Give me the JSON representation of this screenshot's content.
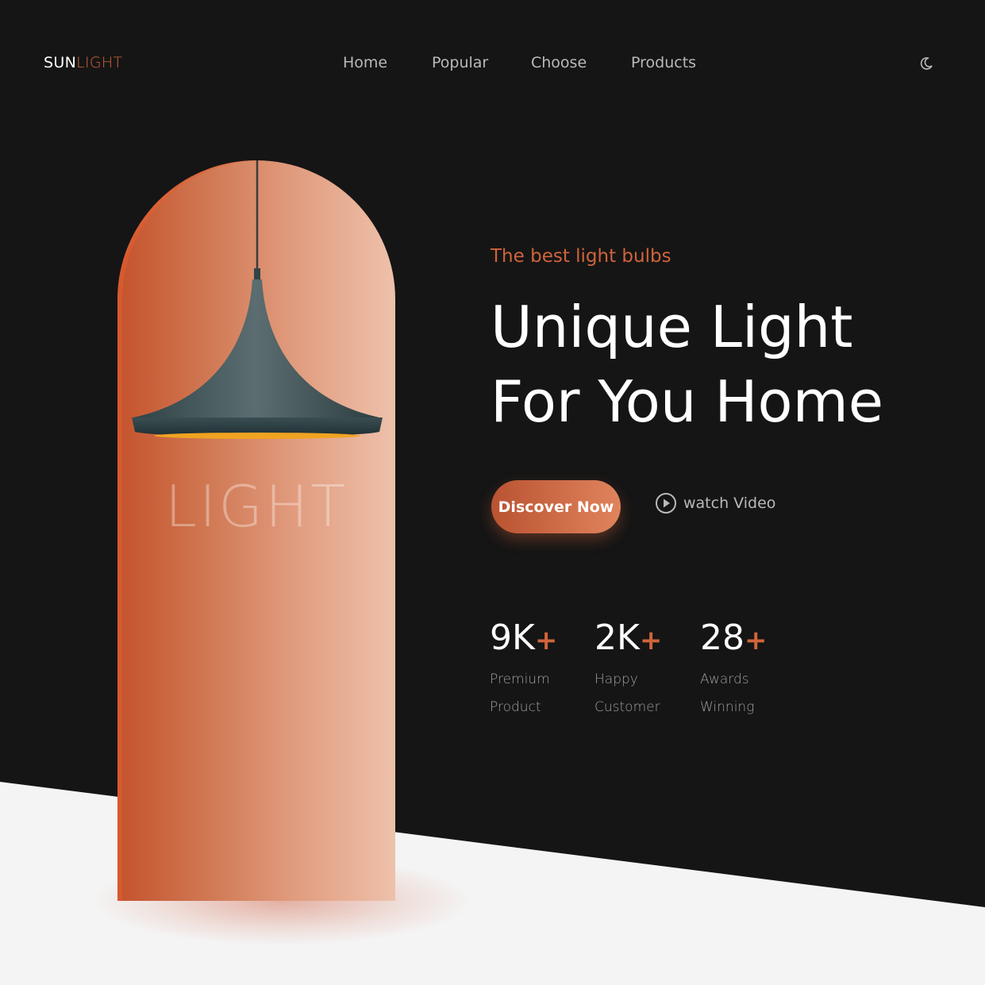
{
  "brand": {
    "part1": "SUN",
    "part2": "LIGHT"
  },
  "nav": [
    "Home",
    "Popular",
    "Choose",
    "Products"
  ],
  "hero": {
    "eyebrow": "The best light bulbs",
    "title_line1": "Unique Light",
    "title_line2": "For You Home",
    "cta_label": "Discover Now",
    "video_label": "watch Video",
    "arch_word": "LIGHT"
  },
  "stats": [
    {
      "value": "9K",
      "suffix": "+",
      "label": "Premium\nProduct"
    },
    {
      "value": "2K",
      "suffix": "+",
      "label": "Happy\nCustomer"
    },
    {
      "value": "28",
      "suffix": "+",
      "label": "Awards\nWinning"
    }
  ],
  "icons": {
    "theme_toggle": "moon-icon",
    "video": "play-circle-icon"
  },
  "colors": {
    "accent": "#d0643b",
    "background": "#151515",
    "light_section": "#f4f4f4"
  }
}
